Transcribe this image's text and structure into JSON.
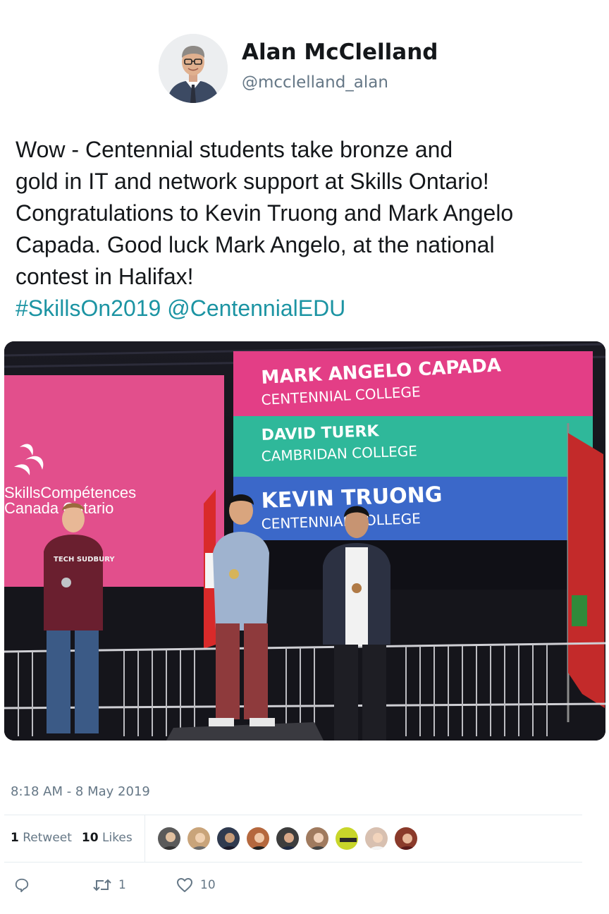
{
  "user": {
    "name": "Alan McClelland",
    "handle": "@mcclelland_alan"
  },
  "tweet": {
    "lines": [
      "Wow - Centennial students take bronze and",
      "gold in IT and network support at Skills Ontario!",
      "Congratulations to Kevin Truong and Mark Angelo",
      "Capada. Good luck Mark Angelo, at the national",
      "contest in Halifax!"
    ],
    "hashtag": "#SkillsOn2019",
    "mention": "@CentennialEDU"
  },
  "photo": {
    "left_screen_logo_line1": "SkillsCompétences",
    "left_screen_logo_line2": "Canada Ontario",
    "winners": [
      {
        "name": "MARK ANGELO CAPADA",
        "school": "CENTENNIAL COLLEGE",
        "color": "#e33e86"
      },
      {
        "name": "DAVID TUERK",
        "school": "CAMBRIDAN COLLEGE",
        "color": "#2fb89a"
      },
      {
        "name": "KEVIN TRUONG",
        "school": "CENTENNIAL COLLEGE",
        "color": "#3b68c9"
      }
    ],
    "shirt_text": "TECH SUDBURY"
  },
  "meta": {
    "timestamp": "8:18 AM - 8 May 2019"
  },
  "stats": {
    "retweets_count": "1",
    "retweets_label": "Retweet",
    "likes_count": "10",
    "likes_label": "Likes"
  },
  "likers": [
    {
      "color": "#5a5a5a"
    },
    {
      "color": "#c9a47a"
    },
    {
      "color": "#2f3a4f"
    },
    {
      "color": "#b5683e"
    },
    {
      "color": "#3d3d3d"
    },
    {
      "color": "#a07a5e"
    },
    {
      "color": "#c8d62a"
    },
    {
      "color": "#d8c0b0"
    },
    {
      "color": "#8a3a2a"
    }
  ],
  "actions": {
    "reply_icon": "reply-icon",
    "retweet_icon": "retweet-icon",
    "retweet_count": "1",
    "like_icon": "heart-icon",
    "like_count": "10"
  },
  "colors": {
    "link": "#1c94a3",
    "muted": "#657786",
    "text": "#14171a"
  }
}
